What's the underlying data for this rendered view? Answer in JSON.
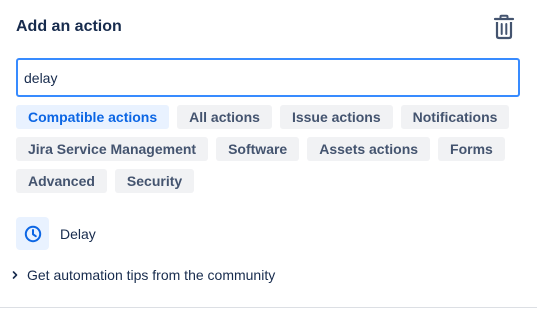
{
  "header": {
    "title": "Add an action",
    "delete_icon": "trash-icon"
  },
  "search": {
    "value": "delay"
  },
  "filters": {
    "rows": [
      [
        "Compatible actions",
        "All actions",
        "Issue actions",
        "Notifications"
      ],
      [
        "Jira Service Management",
        "Software",
        "Assets actions",
        "Forms"
      ],
      [
        "Advanced",
        "Security"
      ]
    ],
    "selected": "Compatible actions"
  },
  "results": [
    {
      "label": "Delay",
      "icon": "clock-icon"
    }
  ],
  "footer": {
    "tips_label": "Get automation tips from the community",
    "tips_icon": "chevron-right-icon"
  },
  "colors": {
    "accent": "#0c66e4",
    "focus_border": "#388bff",
    "chip_bg": "#f1f2f4",
    "chip_selected_bg": "#e9f2ff",
    "text": "#172b4d"
  }
}
